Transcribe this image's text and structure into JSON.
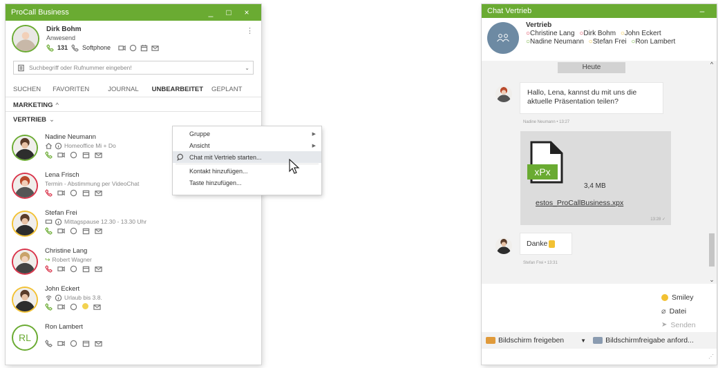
{
  "left_window": {
    "title": "ProCall Business",
    "controls": {
      "minimize": "_",
      "maximize": "□",
      "close": "×"
    },
    "user": {
      "name": "Dirk Bohm",
      "status": "Anwesend",
      "extension": "131",
      "device": "Softphone"
    },
    "search": {
      "placeholder": "Suchbegriff oder Rufnummer eingeben!"
    },
    "tabs": [
      "SUCHEN",
      "FAVORITEN",
      "JOURNAL",
      "UNBEARBEITET",
      "GEPLANT"
    ],
    "groups": {
      "marketing": "MARKETING",
      "vertrieb": "VERTRIEB"
    },
    "contacts": [
      {
        "name": "Nadine Neumann",
        "status": "Homeoffice Mi + Do",
        "ring": "green"
      },
      {
        "name": "Lena Frisch",
        "status": "Termin - Abstimmung per VideoChat",
        "ring": "red"
      },
      {
        "name": "Stefan Frei",
        "status": "Mittagspause 12.30 - 13.30 Uhr",
        "ring": "yellow"
      },
      {
        "name": "Christine Lang",
        "status": "Robert Wagner",
        "ring": "red"
      },
      {
        "name": "John Eckert",
        "status": "Urlaub bis 3.8.",
        "ring": "yellow"
      },
      {
        "name": "Ron Lambert",
        "status": "",
        "initials": "RL",
        "ring": "green"
      }
    ]
  },
  "context_menu": {
    "items": [
      "Gruppe",
      "Ansicht",
      "Chat mit Vertrieb starten...",
      "Kontakt hinzufügen...",
      "Taste hinzufügen..."
    ]
  },
  "right_window": {
    "title": "Chat Vertrieb",
    "control": "–",
    "group_name": "Vertrieb",
    "members": [
      "Christine Lang",
      "Dirk Bohm",
      "John Eckert",
      "Nadine Neumann",
      "Stefan Frei",
      "Ron Lambert"
    ],
    "day_label": "Heute",
    "messages": [
      {
        "text": "Hallo, Lena, kannst du mit uns die aktuelle Präsentation teilen?",
        "meta": "Nadine Neumann • 13:27"
      },
      {
        "file_badge": "xPx",
        "file_size": "3,4 MB",
        "file_name": "estos_ProCallBusiness.xpx",
        "meta": "13:28 ✓"
      },
      {
        "text": "Danke",
        "meta": "Stefan Frei • 13:31"
      }
    ],
    "actions": {
      "smiley": "Smiley",
      "file": "Datei",
      "send": "Senden"
    },
    "bottom": {
      "share": "Bildschirm freigeben",
      "request": "Bildschirmfreigabe anford..."
    }
  },
  "colors": {
    "accent": "#6aab32",
    "away": "#d9334a",
    "busy": "#f2c133"
  }
}
